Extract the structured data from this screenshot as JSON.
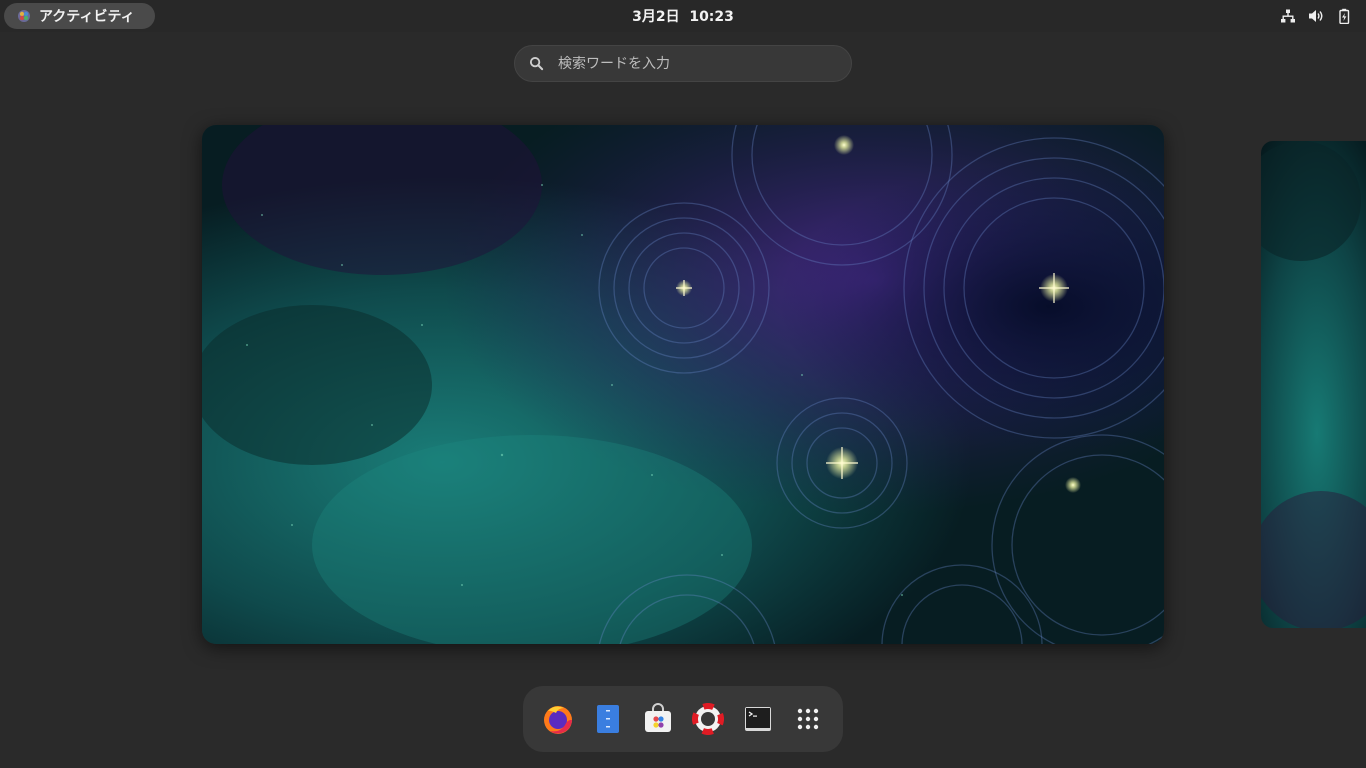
{
  "topbar": {
    "activities_label": "アクティビティ",
    "clock": "3月2日  10:23",
    "tray_icons": [
      "network-icon",
      "volume-icon",
      "battery-icon"
    ]
  },
  "search": {
    "placeholder": "検索ワードを入力"
  },
  "workspaces": {
    "current": "workspace-1",
    "wallpaper": "cosmic-nebula"
  },
  "dash": {
    "items": [
      {
        "name": "firefox",
        "icon": "firefox-icon"
      },
      {
        "name": "text-editor",
        "icon": "text-editor-icon"
      },
      {
        "name": "software",
        "icon": "software-store-icon"
      },
      {
        "name": "help",
        "icon": "help-lifebuoy-icon"
      },
      {
        "name": "terminal",
        "icon": "terminal-icon"
      },
      {
        "name": "show-apps",
        "icon": "app-grid-icon"
      }
    ]
  },
  "colors": {
    "panel": "#282828",
    "overview_bg": "#2a2a2a",
    "dash_bg": "#383838",
    "accent_teal": "#1f8a80",
    "accent_purple": "#4b1e7a"
  }
}
